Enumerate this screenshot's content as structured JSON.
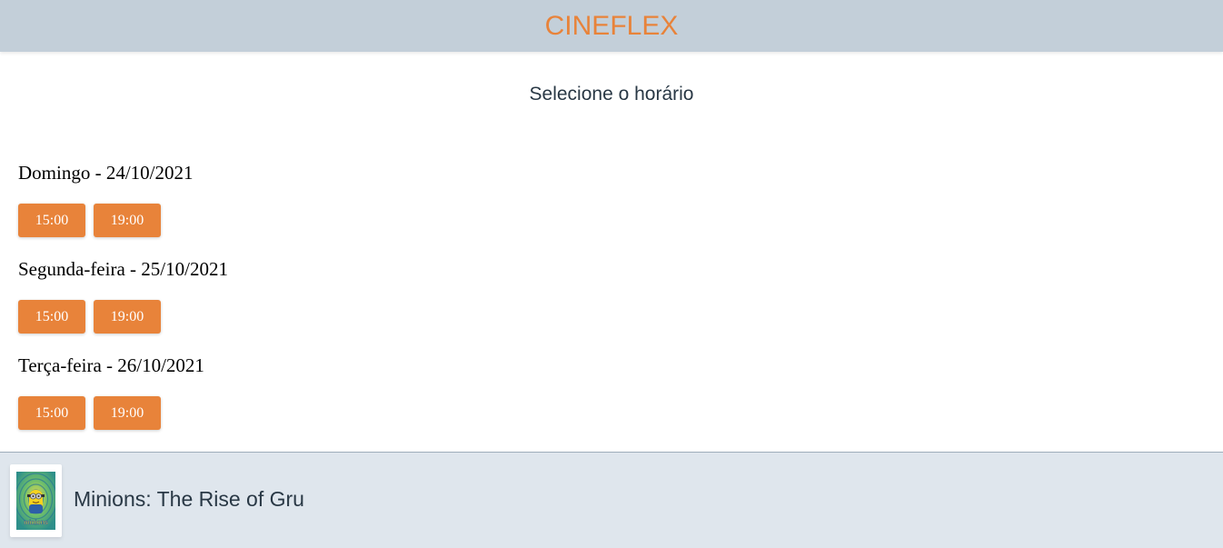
{
  "header": {
    "brand": "CINEFLEX"
  },
  "page": {
    "subtitle": "Selecione o horário"
  },
  "sessions": [
    {
      "date": "Domingo - 24/10/2021",
      "times": [
        "15:00",
        "19:00"
      ]
    },
    {
      "date": "Segunda-feira - 25/10/2021",
      "times": [
        "15:00",
        "19:00"
      ]
    },
    {
      "date": "Terça-feira - 26/10/2021",
      "times": [
        "15:00",
        "19:00"
      ]
    }
  ],
  "footer": {
    "movie_title": "Minions: The Rise of Gru",
    "poster_text": "minions"
  },
  "colors": {
    "accent": "#e8833a",
    "header_bg": "#c3cfd9",
    "footer_bg": "#dfe6ed",
    "text_dark": "#293845"
  }
}
